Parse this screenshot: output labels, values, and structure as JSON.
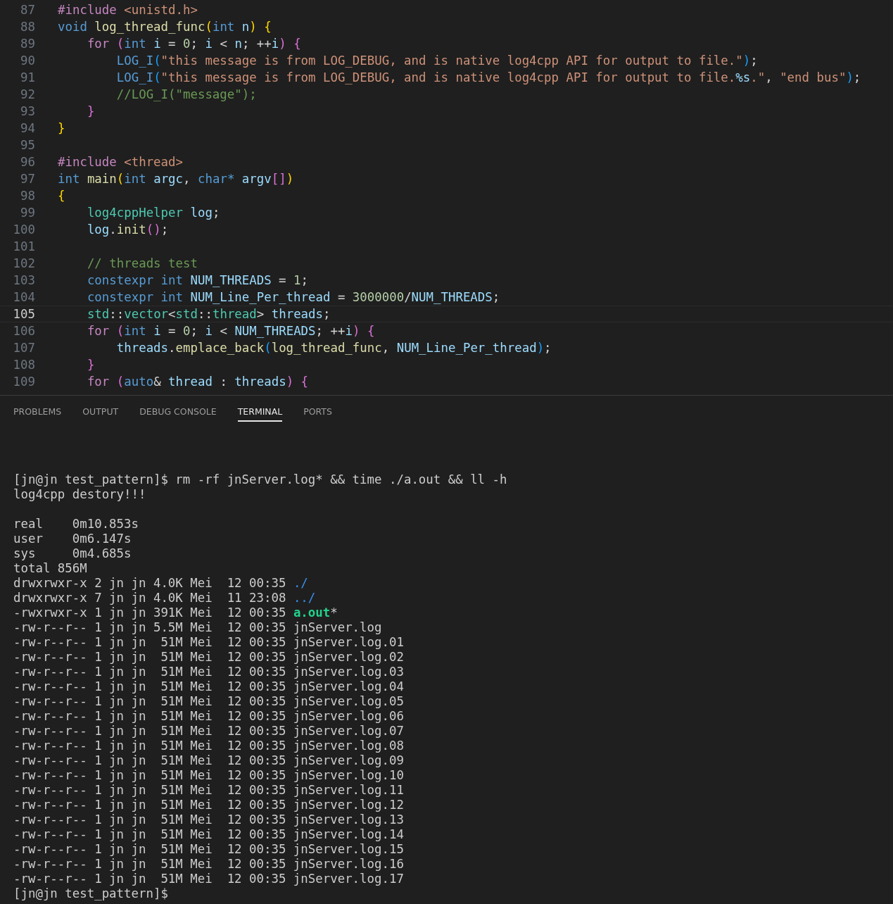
{
  "editor": {
    "lines": [
      {
        "number": "87",
        "current": false,
        "tokens": [
          {
            "kind": "directive",
            "text": "#include "
          },
          {
            "kind": "string",
            "text": "<unistd.h>"
          }
        ]
      },
      {
        "number": "88",
        "current": false,
        "tokens": [
          {
            "kind": "keyword",
            "text": "void "
          },
          {
            "kind": "function",
            "text": "log_thread_func"
          },
          {
            "kind": "bracket1",
            "text": "("
          },
          {
            "kind": "keyword",
            "text": "int "
          },
          {
            "kind": "variable",
            "text": "n"
          },
          {
            "kind": "bracket1",
            "text": ") {"
          }
        ]
      },
      {
        "number": "89",
        "current": false,
        "tokens": [
          {
            "kind": "control",
            "text": "    for "
          },
          {
            "kind": "bracket2",
            "text": "("
          },
          {
            "kind": "keyword",
            "text": "int "
          },
          {
            "kind": "variable",
            "text": "i"
          },
          {
            "kind": "plain",
            "text": " = "
          },
          {
            "kind": "number",
            "text": "0"
          },
          {
            "kind": "plain",
            "text": "; "
          },
          {
            "kind": "variable",
            "text": "i"
          },
          {
            "kind": "plain",
            "text": " < "
          },
          {
            "kind": "variable",
            "text": "n"
          },
          {
            "kind": "plain",
            "text": "; ++"
          },
          {
            "kind": "variable",
            "text": "i"
          },
          {
            "kind": "bracket2",
            "text": ") {"
          }
        ]
      },
      {
        "number": "90",
        "current": false,
        "tokens": [
          {
            "kind": "keyword",
            "text": "        LOG_I"
          },
          {
            "kind": "bracket3",
            "text": "("
          },
          {
            "kind": "string",
            "text": "\"this message is from LOG_DEBUG, and is native log4cpp API for output to file.\""
          },
          {
            "kind": "bracket3",
            "text": ")"
          },
          {
            "kind": "plain",
            "text": ";"
          }
        ]
      },
      {
        "number": "91",
        "current": false,
        "tokens": [
          {
            "kind": "keyword",
            "text": "        LOG_I"
          },
          {
            "kind": "bracket3",
            "text": "("
          },
          {
            "kind": "string",
            "text": "\"this message is from LOG_DEBUG, and is native log4cpp API for output to file."
          },
          {
            "kind": "variable",
            "text": "%s"
          },
          {
            "kind": "string",
            "text": ".\""
          },
          {
            "kind": "plain",
            "text": ", "
          },
          {
            "kind": "string",
            "text": "\"end bus\""
          },
          {
            "kind": "bracket3",
            "text": ")"
          },
          {
            "kind": "plain",
            "text": ";"
          }
        ]
      },
      {
        "number": "92",
        "current": false,
        "tokens": [
          {
            "kind": "comment",
            "text": "        //LOG_I(\"message\");"
          }
        ]
      },
      {
        "number": "93",
        "current": false,
        "tokens": [
          {
            "kind": "bracket2",
            "text": "    }"
          }
        ]
      },
      {
        "number": "94",
        "current": false,
        "tokens": [
          {
            "kind": "bracket1",
            "text": "}"
          }
        ]
      },
      {
        "number": "95",
        "current": false
      },
      {
        "number": "96",
        "current": false,
        "tokens": [
          {
            "kind": "directive",
            "text": "#include "
          },
          {
            "kind": "string",
            "text": "<thread>"
          }
        ]
      },
      {
        "number": "97",
        "current": false,
        "tokens": [
          {
            "kind": "keyword",
            "text": "int "
          },
          {
            "kind": "function",
            "text": "main"
          },
          {
            "kind": "bracket1",
            "text": "("
          },
          {
            "kind": "keyword",
            "text": "int "
          },
          {
            "kind": "variable",
            "text": "argc"
          },
          {
            "kind": "plain",
            "text": ", "
          },
          {
            "kind": "keyword",
            "text": "char* "
          },
          {
            "kind": "variable",
            "text": "argv"
          },
          {
            "kind": "bracket2",
            "text": "[]"
          },
          {
            "kind": "bracket1",
            "text": ")"
          }
        ]
      },
      {
        "number": "98",
        "current": false,
        "tokens": [
          {
            "kind": "bracket1",
            "text": "{"
          }
        ]
      },
      {
        "number": "99",
        "current": false,
        "tokens": [
          {
            "kind": "type",
            "text": "    log4cppHelper "
          },
          {
            "kind": "variable",
            "text": "log"
          },
          {
            "kind": "plain",
            "text": ";"
          }
        ]
      },
      {
        "number": "100",
        "current": false,
        "tokens": [
          {
            "kind": "variable",
            "text": "    log"
          },
          {
            "kind": "plain",
            "text": "."
          },
          {
            "kind": "function",
            "text": "init"
          },
          {
            "kind": "bracket2",
            "text": "()"
          },
          {
            "kind": "plain",
            "text": ";"
          }
        ]
      },
      {
        "number": "101",
        "current": false
      },
      {
        "number": "102",
        "current": false,
        "tokens": [
          {
            "kind": "comment",
            "text": "    // threads test"
          }
        ]
      },
      {
        "number": "103",
        "current": false,
        "tokens": [
          {
            "kind": "keyword",
            "text": "    constexpr int "
          },
          {
            "kind": "variable",
            "text": "NUM_THREADS"
          },
          {
            "kind": "plain",
            "text": " = "
          },
          {
            "kind": "number",
            "text": "1"
          },
          {
            "kind": "plain",
            "text": ";"
          }
        ]
      },
      {
        "number": "104",
        "current": false,
        "tokens": [
          {
            "kind": "keyword",
            "text": "    constexpr int "
          },
          {
            "kind": "variable",
            "text": "NUM_Line_Per_thread"
          },
          {
            "kind": "plain",
            "text": " = "
          },
          {
            "kind": "number",
            "text": "3000000"
          },
          {
            "kind": "plain",
            "text": "/"
          },
          {
            "kind": "variable",
            "text": "NUM_THREADS"
          },
          {
            "kind": "plain",
            "text": ";"
          }
        ]
      },
      {
        "number": "105",
        "current": true,
        "tokens": [
          {
            "kind": "type",
            "text": "    std"
          },
          {
            "kind": "plain",
            "text": "::"
          },
          {
            "kind": "type",
            "text": "vector"
          },
          {
            "kind": "plain",
            "text": "<"
          },
          {
            "kind": "type",
            "text": "std"
          },
          {
            "kind": "plain",
            "text": "::"
          },
          {
            "kind": "type",
            "text": "thread"
          },
          {
            "kind": "plain",
            "text": "> "
          },
          {
            "kind": "variable",
            "text": "threads"
          },
          {
            "kind": "plain",
            "text": ";"
          }
        ]
      },
      {
        "number": "106",
        "current": false,
        "tokens": [
          {
            "kind": "control",
            "text": "    for "
          },
          {
            "kind": "bracket2",
            "text": "("
          },
          {
            "kind": "keyword",
            "text": "int "
          },
          {
            "kind": "variable",
            "text": "i"
          },
          {
            "kind": "plain",
            "text": " = "
          },
          {
            "kind": "number",
            "text": "0"
          },
          {
            "kind": "plain",
            "text": "; "
          },
          {
            "kind": "variable",
            "text": "i"
          },
          {
            "kind": "plain",
            "text": " < "
          },
          {
            "kind": "variable",
            "text": "NUM_THREADS"
          },
          {
            "kind": "plain",
            "text": "; ++"
          },
          {
            "kind": "variable",
            "text": "i"
          },
          {
            "kind": "bracket2",
            "text": ") {"
          }
        ]
      },
      {
        "number": "107",
        "current": false,
        "tokens": [
          {
            "kind": "variable",
            "text": "        threads"
          },
          {
            "kind": "plain",
            "text": "."
          },
          {
            "kind": "function",
            "text": "emplace_back"
          },
          {
            "kind": "bracket3",
            "text": "("
          },
          {
            "kind": "function",
            "text": "log_thread_func"
          },
          {
            "kind": "plain",
            "text": ", "
          },
          {
            "kind": "variable",
            "text": "NUM_Line_Per_thread"
          },
          {
            "kind": "bracket3",
            "text": ")"
          },
          {
            "kind": "plain",
            "text": ";"
          }
        ]
      },
      {
        "number": "108",
        "current": false,
        "tokens": [
          {
            "kind": "bracket2",
            "text": "    }"
          }
        ]
      },
      {
        "number": "109",
        "current": false,
        "tokens": [
          {
            "kind": "control",
            "text": "    for "
          },
          {
            "kind": "bracket2",
            "text": "("
          },
          {
            "kind": "keyword",
            "text": "auto"
          },
          {
            "kind": "plain",
            "text": "& "
          },
          {
            "kind": "variable",
            "text": "thread"
          },
          {
            "kind": "plain",
            "text": " : "
          },
          {
            "kind": "variable",
            "text": "threads"
          },
          {
            "kind": "bracket2",
            "text": ") {"
          }
        ]
      }
    ]
  },
  "panel": {
    "tabs": [
      {
        "label": "PROBLEMS",
        "selected": false
      },
      {
        "label": "OUTPUT",
        "selected": false
      },
      {
        "label": "DEBUG CONSOLE",
        "selected": false
      },
      {
        "label": "TERMINAL",
        "selected": true
      },
      {
        "label": "PORTS",
        "selected": false
      }
    ],
    "terminal": {
      "blocks": [
        {
          "lines": [
            {
              "segments": [
                {
                  "kind": "plain",
                  "text": "[jn@jn test_pattern]$ rm -rf jnServer.log* && time ./a.out && ll -h"
                }
              ]
            },
            {
              "segments": [
                {
                  "kind": "plain",
                  "text": "log4cpp destory!!!"
                }
              ]
            }
          ]
        },
        {
          "lines": [
            {
              "segments": [
                {
                  "kind": "plain",
                  "text": "real\t0m10.853s"
                }
              ]
            },
            {
              "segments": [
                {
                  "kind": "plain",
                  "text": "user\t0m6.147s"
                }
              ]
            },
            {
              "segments": [
                {
                  "kind": "plain",
                  "text": "sys\t0m4.685s"
                }
              ]
            },
            {
              "segments": [
                {
                  "kind": "plain",
                  "text": "total 856M"
                }
              ]
            },
            {
              "segments": [
                {
                  "kind": "plain",
                  "text": "drwxrwxr-x 2 jn jn 4.0K Mei  12 00:35 "
                },
                {
                  "kind": "directory",
                  "text": "./"
                }
              ]
            },
            {
              "segments": [
                {
                  "kind": "plain",
                  "text": "drwxrwxr-x 7 jn jn 4.0K Mei  11 23:08 "
                },
                {
                  "kind": "directory",
                  "text": "../"
                }
              ]
            },
            {
              "segments": [
                {
                  "kind": "plain",
                  "text": "-rwxrwxr-x 1 jn jn 391K Mei  12 00:35 "
                },
                {
                  "kind": "executable",
                  "text": "a.out"
                },
                {
                  "kind": "plain",
                  "text": "*"
                }
              ]
            },
            {
              "segments": [
                {
                  "kind": "plain",
                  "text": "-rw-r--r-- 1 jn jn 5.5M Mei  12 00:35 jnServer.log"
                }
              ]
            },
            {
              "segments": [
                {
                  "kind": "plain",
                  "text": "-rw-r--r-- 1 jn jn  51M Mei  12 00:35 jnServer.log.01"
                }
              ]
            },
            {
              "segments": [
                {
                  "kind": "plain",
                  "text": "-rw-r--r-- 1 jn jn  51M Mei  12 00:35 jnServer.log.02"
                }
              ]
            },
            {
              "segments": [
                {
                  "kind": "plain",
                  "text": "-rw-r--r-- 1 jn jn  51M Mei  12 00:35 jnServer.log.03"
                }
              ]
            },
            {
              "segments": [
                {
                  "kind": "plain",
                  "text": "-rw-r--r-- 1 jn jn  51M Mei  12 00:35 jnServer.log.04"
                }
              ]
            },
            {
              "segments": [
                {
                  "kind": "plain",
                  "text": "-rw-r--r-- 1 jn jn  51M Mei  12 00:35 jnServer.log.05"
                }
              ]
            },
            {
              "segments": [
                {
                  "kind": "plain",
                  "text": "-rw-r--r-- 1 jn jn  51M Mei  12 00:35 jnServer.log.06"
                }
              ]
            },
            {
              "segments": [
                {
                  "kind": "plain",
                  "text": "-rw-r--r-- 1 jn jn  51M Mei  12 00:35 jnServer.log.07"
                }
              ]
            },
            {
              "segments": [
                {
                  "kind": "plain",
                  "text": "-rw-r--r-- 1 jn jn  51M Mei  12 00:35 jnServer.log.08"
                }
              ]
            },
            {
              "segments": [
                {
                  "kind": "plain",
                  "text": "-rw-r--r-- 1 jn jn  51M Mei  12 00:35 jnServer.log.09"
                }
              ]
            },
            {
              "segments": [
                {
                  "kind": "plain",
                  "text": "-rw-r--r-- 1 jn jn  51M Mei  12 00:35 jnServer.log.10"
                }
              ]
            },
            {
              "segments": [
                {
                  "kind": "plain",
                  "text": "-rw-r--r-- 1 jn jn  51M Mei  12 00:35 jnServer.log.11"
                }
              ]
            },
            {
              "segments": [
                {
                  "kind": "plain",
                  "text": "-rw-r--r-- 1 jn jn  51M Mei  12 00:35 jnServer.log.12"
                }
              ]
            },
            {
              "segments": [
                {
                  "kind": "plain",
                  "text": "-rw-r--r-- 1 jn jn  51M Mei  12 00:35 jnServer.log.13"
                }
              ]
            },
            {
              "segments": [
                {
                  "kind": "plain",
                  "text": "-rw-r--r-- 1 jn jn  51M Mei  12 00:35 jnServer.log.14"
                }
              ]
            },
            {
              "segments": [
                {
                  "kind": "plain",
                  "text": "-rw-r--r-- 1 jn jn  51M Mei  12 00:35 jnServer.log.15"
                }
              ]
            },
            {
              "segments": [
                {
                  "kind": "plain",
                  "text": "-rw-r--r-- 1 jn jn  51M Mei  12 00:35 jnServer.log.16"
                }
              ]
            },
            {
              "segments": [
                {
                  "kind": "plain",
                  "text": "-rw-r--r-- 1 jn jn  51M Mei  12 00:35 jnServer.log.17"
                }
              ]
            },
            {
              "segments": [
                {
                  "kind": "plain",
                  "text": "[jn@jn test_pattern]$"
                }
              ]
            }
          ]
        }
      ]
    }
  }
}
